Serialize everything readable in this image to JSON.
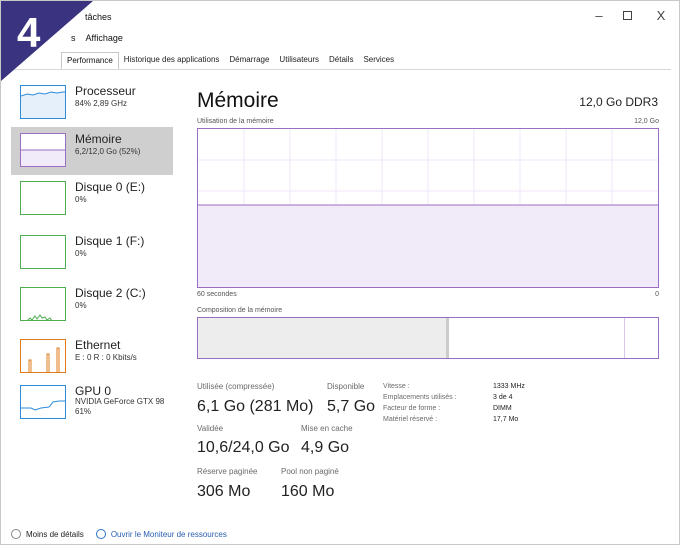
{
  "badge": {
    "number": "4",
    "color": "#3a3480"
  },
  "window": {
    "title": "tâches",
    "controls": {
      "minimize": "–",
      "close": "X"
    }
  },
  "menu": [
    "s",
    "Affichage"
  ],
  "tabs": [
    {
      "label": "Performance",
      "active": true
    },
    {
      "label": "Historique des applications",
      "active": false
    },
    {
      "label": "Démarrage",
      "active": false
    },
    {
      "label": "Utilisateurs",
      "active": false
    },
    {
      "label": "Détails",
      "active": false
    },
    {
      "label": "Services",
      "active": false
    }
  ],
  "resources": [
    {
      "name": "Processeur",
      "sub": "84% 2,89 GHz",
      "selected": false
    },
    {
      "name": "Mémoire",
      "sub": "6,2/12,0 Go (52%)",
      "selected": true
    },
    {
      "name": "Disque 0 (E:)",
      "sub": "0%",
      "selected": false
    },
    {
      "name": "Disque 1 (F:)",
      "sub": "0%",
      "selected": false
    },
    {
      "name": "Disque 2 (C:)",
      "sub": "0%",
      "selected": false
    },
    {
      "name": "Ethernet",
      "sub": "E : 0 R : 0 Kbits/s",
      "selected": false
    },
    {
      "name": "GPU 0",
      "sub": "NVIDIA GeForce GTX 98",
      "sub2": "61%",
      "selected": false
    }
  ],
  "main": {
    "title": "Mémoire",
    "spec": "12,0 Go DDR3",
    "usage_label": "Utilisation de la mémoire",
    "usage_max": "12,0 Go",
    "time_label": "60 secondes",
    "time_min": "0",
    "composition_label": "Composition de la mémoire",
    "memory_usage_fraction": 0.52
  },
  "stats": {
    "used_label": "Utilisée (compressée)",
    "used_value": "6,1 Go (281 Mo)",
    "available_label": "Disponible",
    "available_value": "5,7 Go",
    "committed_label": "Validée",
    "committed_value": "10,6/24,0 Go",
    "cached_label": "Mise en cache",
    "cached_value": "4,9 Go",
    "paged_label": "Réserve paginée",
    "paged_value": "306 Mo",
    "nonpaged_label": "Pool non paginé",
    "nonpaged_value": "160 Mo"
  },
  "specs": [
    {
      "label": "Vitesse :",
      "value": "1333 MHz"
    },
    {
      "label": "Emplacements utilisés :",
      "value": "3 de 4"
    },
    {
      "label": "Facteur de forme :",
      "value": "DIMM"
    },
    {
      "label": "Matériel réservé :",
      "value": "17,7 Mo"
    }
  ],
  "footer": {
    "less_details": "Moins de détails",
    "open_monitor": "Ouvrir le Moniteur de ressources"
  },
  "colors": {
    "memory_accent": "#9b6ec3",
    "cpu_accent": "#2e8bd8",
    "disk_accent": "#4caf50",
    "ethernet_accent": "#e07b1a",
    "gpu_accent": "#2e8bd8"
  }
}
